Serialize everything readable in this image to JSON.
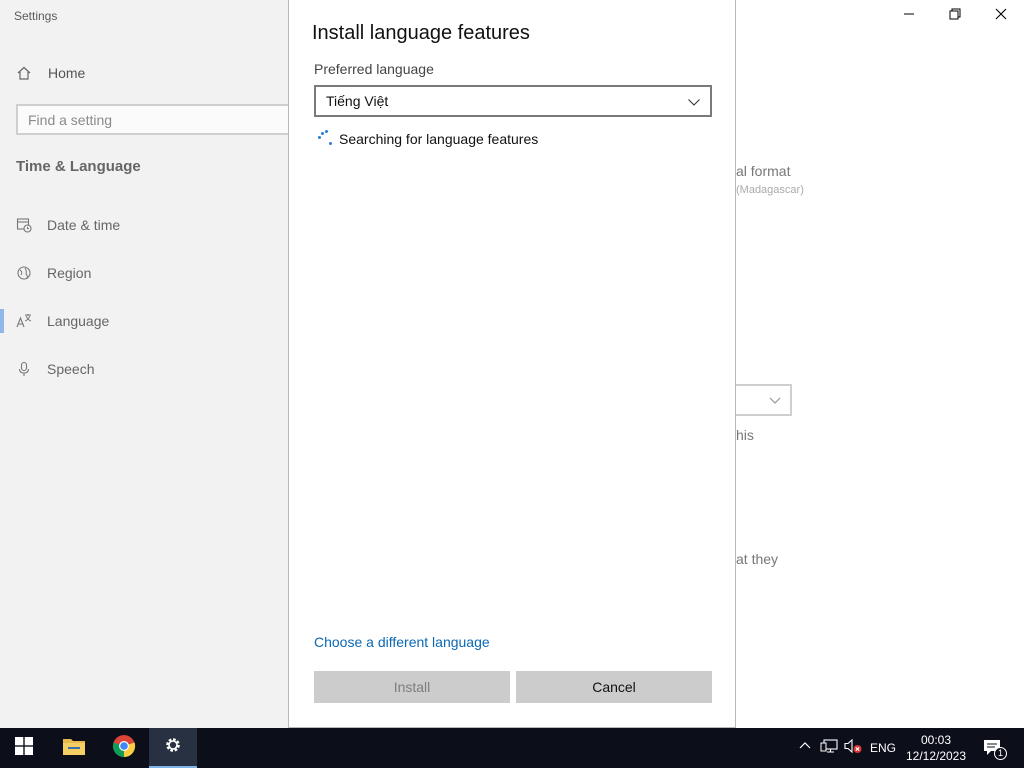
{
  "window": {
    "title": "Settings",
    "controls": {
      "minimize": "minimize-icon",
      "restore": "restore-icon",
      "close": "close-icon"
    }
  },
  "sidebar": {
    "home_label": "Home",
    "search_placeholder": "Find a setting",
    "section_title": "Time & Language",
    "items": [
      {
        "label": "Date & time",
        "icon": "calendar-clock-icon"
      },
      {
        "label": "Region",
        "icon": "globe-icon"
      },
      {
        "label": "Language",
        "icon": "language-icon",
        "active": true
      },
      {
        "label": "Speech",
        "icon": "microphone-icon"
      }
    ]
  },
  "background_content": {
    "regional_format_fragment": "al format",
    "regional_format_value_fragment": "(Madagascar)",
    "this_fragment": "his",
    "they_fragment": "at they"
  },
  "dialog": {
    "title": "Install language features",
    "preferred_language_label": "Preferred language",
    "selected_language": "Tiếng Việt",
    "status_text": "Searching for language features",
    "choose_link": "Choose a different language",
    "install_button": "Install",
    "cancel_button": "Cancel"
  },
  "taskbar": {
    "apps": [
      "start-icon",
      "file-explorer-icon",
      "chrome-icon",
      "settings-icon"
    ],
    "language": "ENG",
    "time": "00:03",
    "date": "12/12/2023",
    "notification_count": "1"
  },
  "colors": {
    "accent": "#0b68b3",
    "sidebar_bg": "#f2f2f2",
    "taskbar_bg": "#0c0f1a",
    "button_bg": "#cccccc"
  }
}
